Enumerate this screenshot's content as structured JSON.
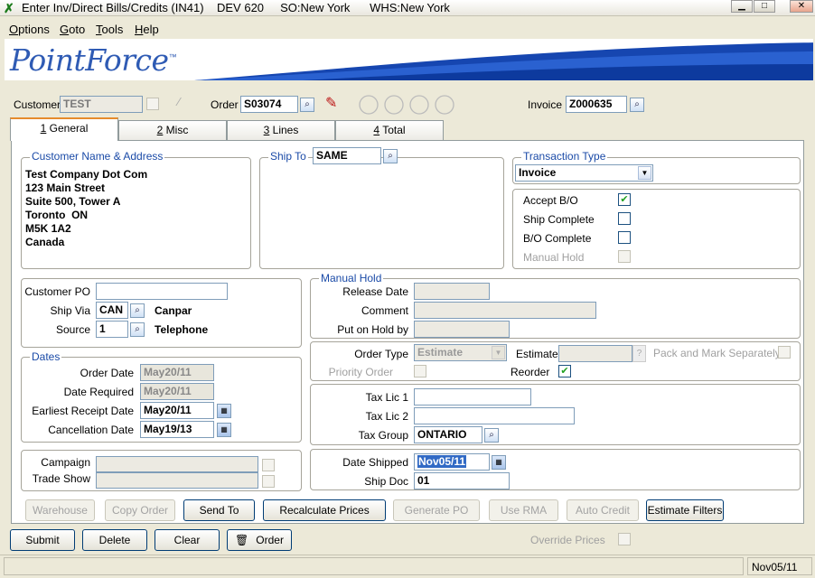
{
  "window": {
    "title": "Enter Inv/Direct Bills/Credits (IN41)    DEV 620     SO:New York      WHS:New York"
  },
  "menu": [
    {
      "label": "Options",
      "u": "O",
      "rest": "ptions"
    },
    {
      "label": "Goto",
      "u": "G",
      "rest": "oto"
    },
    {
      "label": "Tools",
      "u": "T",
      "rest": "ools"
    },
    {
      "label": "Help",
      "u": "H",
      "rest": "elp"
    }
  ],
  "brand": {
    "logo": "PointForce",
    "tm": "™"
  },
  "header": {
    "customer_label": "Customer",
    "customer_value": "TEST",
    "order_label": "Order",
    "order_value": "S03074",
    "invoice_label": "Invoice",
    "invoice_value": "Z000635"
  },
  "tabs": [
    {
      "num": "1",
      "label": " General"
    },
    {
      "num": "2",
      "label": " Misc"
    },
    {
      "num": "3",
      "label": " Lines"
    },
    {
      "num": "4",
      "label": " Total"
    }
  ],
  "customer_address": {
    "title": "Customer Name & Address",
    "lines": [
      "Test Company Dot Com",
      "123 Main Street",
      "Suite 500, Tower A",
      "Toronto  ON",
      "M5K 1A2",
      "Canada"
    ]
  },
  "ship_to": {
    "label": "Ship To",
    "value": "SAME"
  },
  "transaction_type": {
    "title": "Transaction Type",
    "value": "Invoice"
  },
  "flags": {
    "accept_bo": "Accept B/O",
    "ship_complete": "Ship Complete",
    "bo_complete": "B/O Complete",
    "manual_hold": "Manual Hold"
  },
  "order_info": {
    "customer_po_label": "Customer PO",
    "customer_po": "",
    "ship_via_label": "Ship Via",
    "ship_via": "CAN",
    "ship_via_desc": "Canpar",
    "source_label": "Source",
    "source": "1",
    "source_desc": "Telephone"
  },
  "manual_hold": {
    "title": "Manual Hold",
    "release_date_label": "Release Date",
    "comment_label": "Comment",
    "put_on_hold_label": "Put on Hold by"
  },
  "dates": {
    "title": "Dates",
    "order_date_label": "Order Date",
    "order_date": "May20/11",
    "date_required_label": "Date Required",
    "date_required": "May20/11",
    "earliest_label": "Earliest Receipt Date",
    "earliest": "May20/11",
    "cancel_label": "Cancellation Date",
    "cancel": "May19/13"
  },
  "order_type": {
    "label": "Order Type",
    "value": "Estimate",
    "estimate_label": "Estimate",
    "pack_label": "Pack and Mark Separately",
    "priority_label": "Priority Order",
    "reorder_label": "Reorder"
  },
  "tax": {
    "lic1_label": "Tax Lic 1",
    "lic2_label": "Tax Lic 2",
    "group_label": "Tax Group",
    "group_value": "ONTARIO"
  },
  "campaign": {
    "campaign_label": "Campaign",
    "trade_show_label": "Trade Show"
  },
  "shipping": {
    "date_shipped_label": "Date Shipped",
    "date_shipped": "Nov05/11",
    "ship_doc_label": "Ship Doc",
    "ship_doc": "01"
  },
  "action_buttons": {
    "warehouse": "Warehouse",
    "copy_order": "Copy Order",
    "send_to": "Send To",
    "recalc": "Recalculate Prices",
    "generate_po": "Generate PO",
    "use_rma": "Use RMA",
    "auto_credit": "Auto Credit",
    "estimate_filters": "Estimate Filters"
  },
  "bottom_buttons": {
    "submit": "Submit",
    "delete": "Delete",
    "clear": "Clear",
    "order": "Order",
    "override_prices": "Override Prices"
  },
  "status": {
    "date": "Nov05/11"
  }
}
